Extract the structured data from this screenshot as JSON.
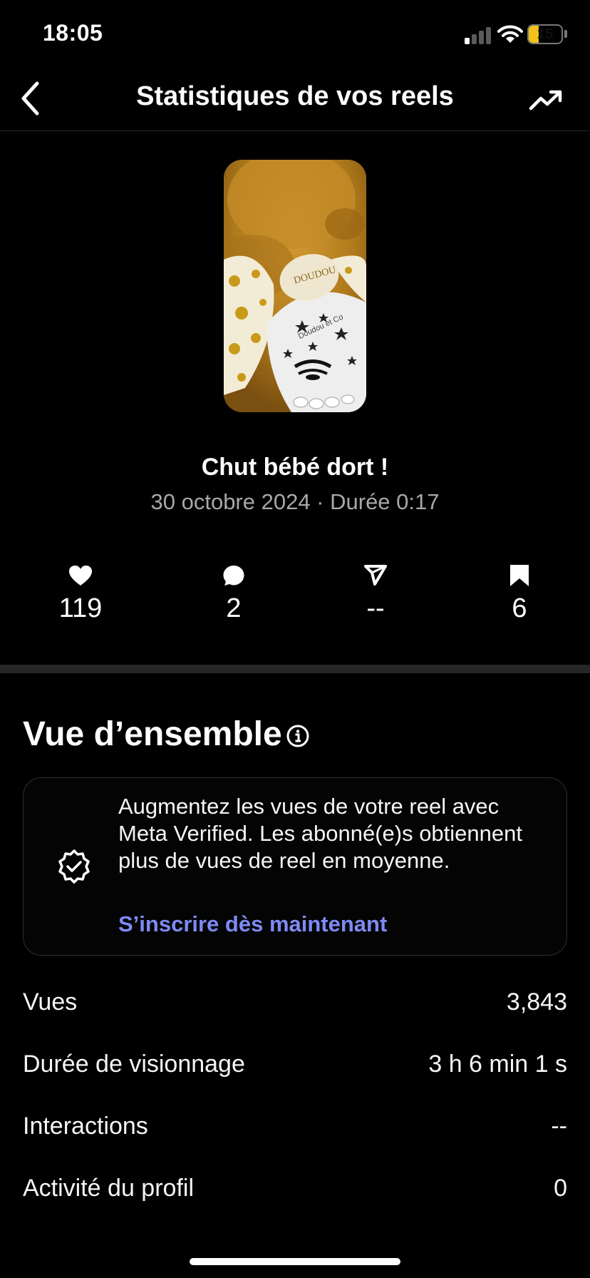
{
  "status_bar": {
    "time": "18:05",
    "battery": "15"
  },
  "header": {
    "title": "Statistiques de vos reels"
  },
  "reel": {
    "title": "Chut bébé dort !",
    "meta": "30 octobre 2024 · Durée 0:17",
    "thumbnail_label_1": "DOUDOU",
    "thumbnail_label_2": "Doudou et Co"
  },
  "stats": [
    {
      "icon": "heart-icon",
      "value": "119"
    },
    {
      "icon": "comment-icon",
      "value": "2"
    },
    {
      "icon": "share-icon",
      "value": "--"
    },
    {
      "icon": "bookmark-icon",
      "value": "6"
    }
  ],
  "overview": {
    "title": "Vue d’ensemble",
    "promo_text": "Augmentez les vues de votre reel avec Meta Verified. Les abonné(e)s obtiennent plus de vues de reel en moyenne.",
    "promo_link": "S’inscrire dès maintenant",
    "link_color": "#7d8bf5"
  },
  "metrics": [
    {
      "label": "Vues",
      "value": "3,843"
    },
    {
      "label": "Durée de visionnage",
      "value": "3 h 6 min 1 s"
    },
    {
      "label": "Interactions",
      "value": "--"
    },
    {
      "label": "Activité du profil",
      "value": "0"
    }
  ]
}
